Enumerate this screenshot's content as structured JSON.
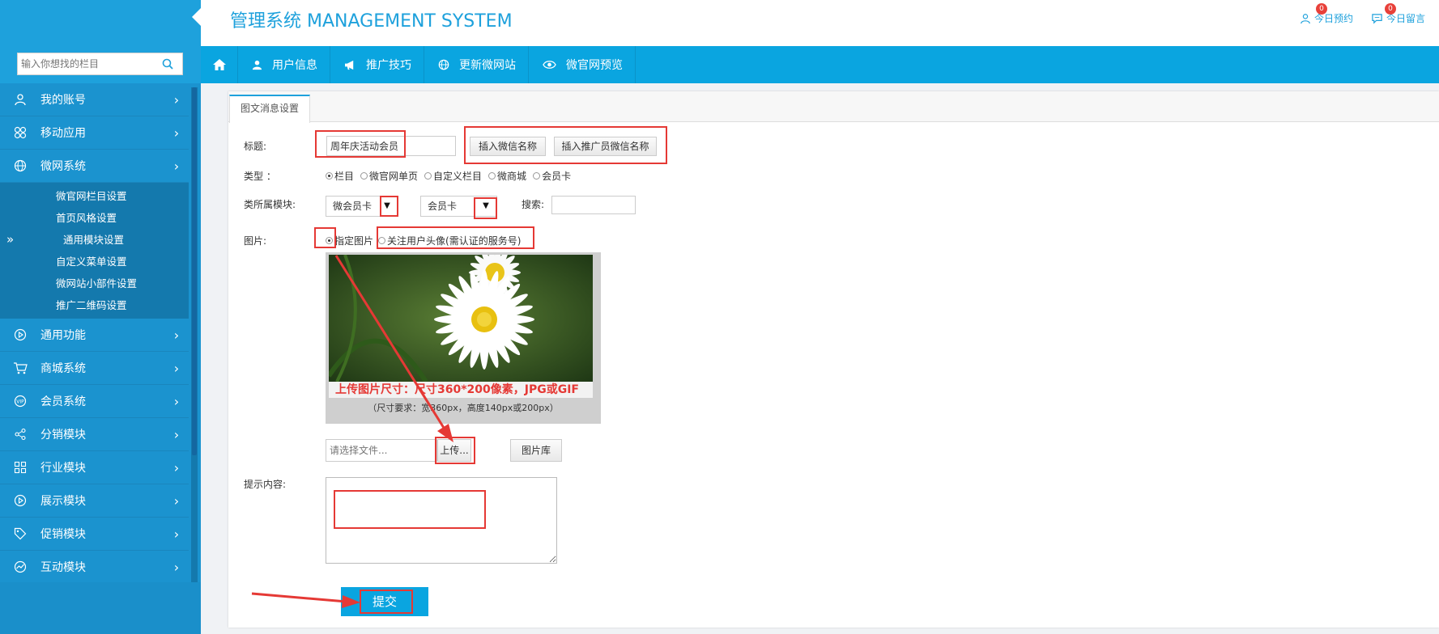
{
  "header": {
    "brand": "管理系统 MANAGEMENT SYSTEM",
    "links": [
      {
        "label": "今日预约",
        "badge": "0",
        "icon": "user-icon"
      },
      {
        "label": "今日留言",
        "badge": "0",
        "icon": "message-icon"
      }
    ]
  },
  "sidebar": {
    "search_placeholder": "输入你想找的栏目",
    "items": [
      {
        "label": "我的账号",
        "icon": "user-icon"
      },
      {
        "label": "移动应用",
        "icon": "apps-icon"
      },
      {
        "label": "微网系统",
        "icon": "globe-icon"
      },
      {
        "label": "通用功能",
        "icon": "play-circle-icon"
      },
      {
        "label": "商城系统",
        "icon": "cart-icon"
      },
      {
        "label": "会员系统",
        "icon": "vip-icon"
      },
      {
        "label": "分销模块",
        "icon": "share-icon"
      },
      {
        "label": "行业模块",
        "icon": "grid-icon"
      },
      {
        "label": "展示模块",
        "icon": "play-circle-icon"
      },
      {
        "label": "促销模块",
        "icon": "tag-icon"
      },
      {
        "label": "互动模块",
        "icon": "chart-icon"
      }
    ],
    "submenu": [
      "微官网栏目设置",
      "首页风格设置",
      "通用模块设置",
      "自定义菜单设置",
      "微网站小部件设置",
      "推广二维码设置"
    ],
    "active_marker": "»"
  },
  "topnav": {
    "items": [
      {
        "label": "用户信息",
        "icon": "user-icon"
      },
      {
        "label": "推广技巧",
        "icon": "megaphone-icon"
      },
      {
        "label": "更新微网站",
        "icon": "globe-icon"
      },
      {
        "label": "微官网预览",
        "icon": "eye-icon"
      }
    ]
  },
  "form": {
    "tab": "图文消息设置",
    "title_label": "标题:",
    "title_value": "周年庆活动会员",
    "insert_wechat_name": "插入微信名称",
    "insert_promoter_name": "插入推广员微信名称",
    "type_label": "类型 ：",
    "types": [
      {
        "label": "栏目",
        "checked": true
      },
      {
        "label": "微官网单页",
        "checked": false
      },
      {
        "label": "自定义栏目",
        "checked": false
      },
      {
        "label": "微商城",
        "checked": false
      },
      {
        "label": "会员卡",
        "checked": false
      }
    ],
    "module_label": "类所属模块:",
    "module_select_1": "微会员卡",
    "module_select_2": "会员卡",
    "search_label": "搜索:",
    "image_label": "图片:",
    "image_options": [
      {
        "label": "指定图片",
        "checked": true
      },
      {
        "label": "关注用户头像(需认证的服务号)",
        "checked": false
      }
    ],
    "image_caption": "上传图片尺寸：尺寸360*200像素，JPG或GIF",
    "image_requirement": "（尺寸要求：宽360px，高度140px或200px）",
    "file_placeholder": "请选择文件...",
    "upload_button": "上传...",
    "gallery_button": "图片库",
    "hint_label": "提示内容:",
    "submit": "提交"
  },
  "colors": {
    "primary": "#0aa5e0",
    "sidebar": "#1b93cf",
    "annotation": "#e53935"
  }
}
